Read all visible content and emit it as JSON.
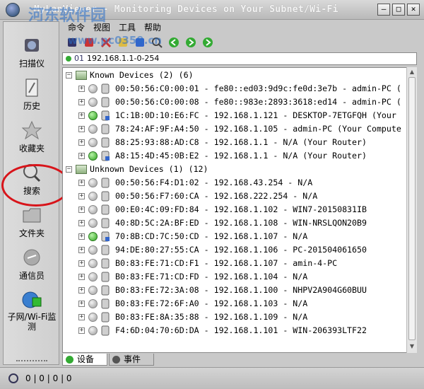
{
  "window": {
    "title": "MyLanViewer - Monitoring Devices on Your Subnet/Wi-Fi",
    "watermark": "河东软件园",
    "watermark_url": "www.pc0359.cn",
    "minimize_glyph": "—",
    "maximize_glyph": "□",
    "close_glyph": "✕"
  },
  "sidebar": {
    "items": [
      {
        "label": "扫描仪",
        "icon": "scanner-icon"
      },
      {
        "label": "历史",
        "icon": "history-icon"
      },
      {
        "label": "收藏夹",
        "icon": "favorites-star-icon"
      },
      {
        "label": "搜索",
        "icon": "search-icon"
      },
      {
        "label": "文件夹",
        "icon": "folder-icon"
      },
      {
        "label": "通信员",
        "icon": "messenger-icon"
      },
      {
        "label": "子网/Wi-Fi监测",
        "icon": "wifi-monitor-icon"
      }
    ],
    "highlight_color": "#d8141a"
  },
  "menu": [
    "命令",
    "视图",
    "工具",
    "帮助"
  ],
  "toolbar": [
    "scan-icon",
    "stop-icon",
    "delete-icon",
    "folder-open-icon",
    "save-icon",
    "find-icon",
    "back-icon",
    "forward-icon",
    "refresh-icon"
  ],
  "address": {
    "prefix": "01",
    "range": "192.168.1.1-0-254"
  },
  "tree": {
    "known_group": "Known Devices (2) (6)",
    "known": [
      {
        "text": "00:50:56:C0:00:01 - fe80::ed03:9d9c:fe0d:3e7b - admin-PC (",
        "status": "gray"
      },
      {
        "text": "00:50:56:C0:00:08 - fe80::983e:2893:3618:ed14 - admin-PC (",
        "status": "gray"
      },
      {
        "text": "1C:1B:0D:10:E6:FC - 192.168.1.121 - DESKTOP-7ETGFQH (Your",
        "status": "green"
      },
      {
        "text": "78:24:AF:9F:A4:50 - 192.168.1.105 - admin-PC (Your Compute",
        "status": "gray"
      },
      {
        "text": "88:25:93:88:AD:C8 - 192.168.1.1 - N/A (Your Router)",
        "status": "gray"
      },
      {
        "text": "A8:15:4D:45:0B:E2 - 192.168.1.1 - N/A (Your Router)",
        "status": "green"
      }
    ],
    "unknown_group": "Unknown Devices (1) (12)",
    "unknown": [
      {
        "text": "00:50:56:F4:D1:02 - 192.168.43.254 - N/A",
        "status": "gray"
      },
      {
        "text": "00:50:56:F7:60:CA - 192.168.222.254 - N/A",
        "status": "gray"
      },
      {
        "text": "00:E0:4C:09:FD:84 - 192.168.1.102 - WIN7-20150831IB",
        "status": "gray"
      },
      {
        "text": "40:8D:5C:2A:BF:ED - 192.168.1.108 - WIN-NRSLQON20B9",
        "status": "gray"
      },
      {
        "text": "70:8B:CD:7C:50:CD - 192.168.1.107 - N/A",
        "status": "green"
      },
      {
        "text": "94:DE:80:27:55:CA - 192.168.1.106 - PC-201504061650",
        "status": "gray"
      },
      {
        "text": "B0:83:FE:71:CD:F1 - 192.168.1.107 - amin-4-PC",
        "status": "gray"
      },
      {
        "text": "B0:83:FE:71:CD:FD - 192.168.1.104 - N/A",
        "status": "gray"
      },
      {
        "text": "B0:83:FE:72:3A:08 - 192.168.1.100 - NHPV2A904G60BUU",
        "status": "gray"
      },
      {
        "text": "B0:83:FE:72:6F:A0 - 192.168.1.103 - N/A",
        "status": "gray"
      },
      {
        "text": "B0:83:FE:8A:35:88 - 192.168.1.109 - N/A",
        "status": "gray"
      },
      {
        "text": "F4:6D:04:70:6D:DA - 192.168.1.101 - WIN-206393LTF22",
        "status": "gray"
      }
    ]
  },
  "tabs": [
    {
      "label": "设备",
      "active": true
    },
    {
      "label": "事件",
      "active": false
    }
  ],
  "statusbar": {
    "text": "0 | 0 | 0 | 0"
  },
  "colors": {
    "online_green": "#2ea31e",
    "offline_gray": "#9a9a9a",
    "highlight_red": "#d8141a"
  }
}
